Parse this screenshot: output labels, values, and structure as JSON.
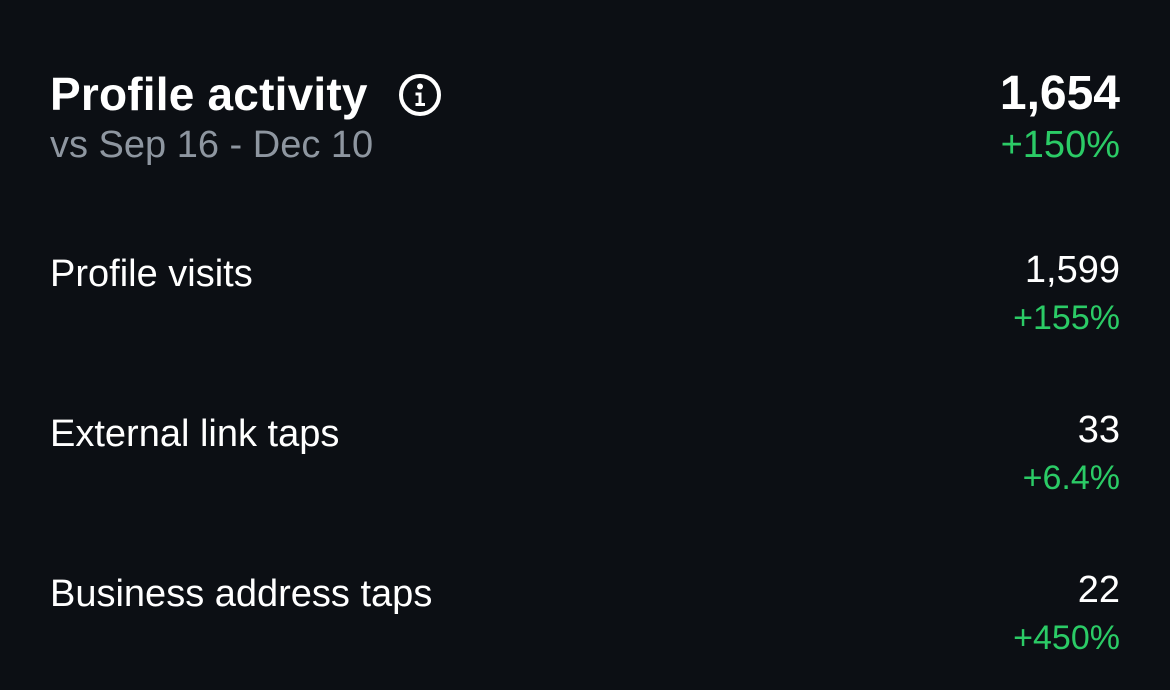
{
  "header": {
    "title": "Profile activity",
    "info_icon": "info-circle-icon",
    "subtitle": "vs Sep 16 - Dec 10",
    "total": "1,654",
    "total_change": "+150%"
  },
  "metrics": [
    {
      "label": "Profile visits",
      "value": "1,599",
      "change": "+155%"
    },
    {
      "label": "External link taps",
      "value": "33",
      "change": "+6.4%"
    },
    {
      "label": "Business address taps",
      "value": "22",
      "change": "+450%"
    }
  ],
  "colors": {
    "background": "#0c0f14",
    "text": "#ffffff",
    "muted": "#8e96a0",
    "positive": "#2bcb66"
  }
}
